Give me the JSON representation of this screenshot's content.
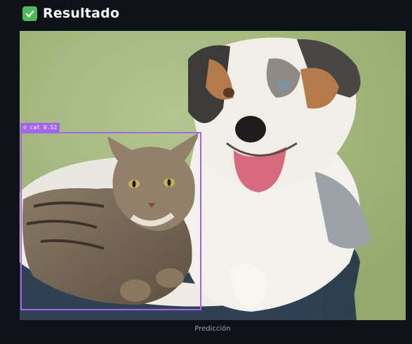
{
  "header": {
    "icon": "check-mark-button-icon",
    "title": "Resultado"
  },
  "image": {
    "detections": [
      {
        "label": "o cat 0.52",
        "class": "cat",
        "confidence": 0.52,
        "box_color": "#a165ee"
      }
    ],
    "caption": "Predicción"
  },
  "colors": {
    "background": "#0e1117",
    "check_icon": "#4fb85a",
    "box": "#a165ee"
  }
}
